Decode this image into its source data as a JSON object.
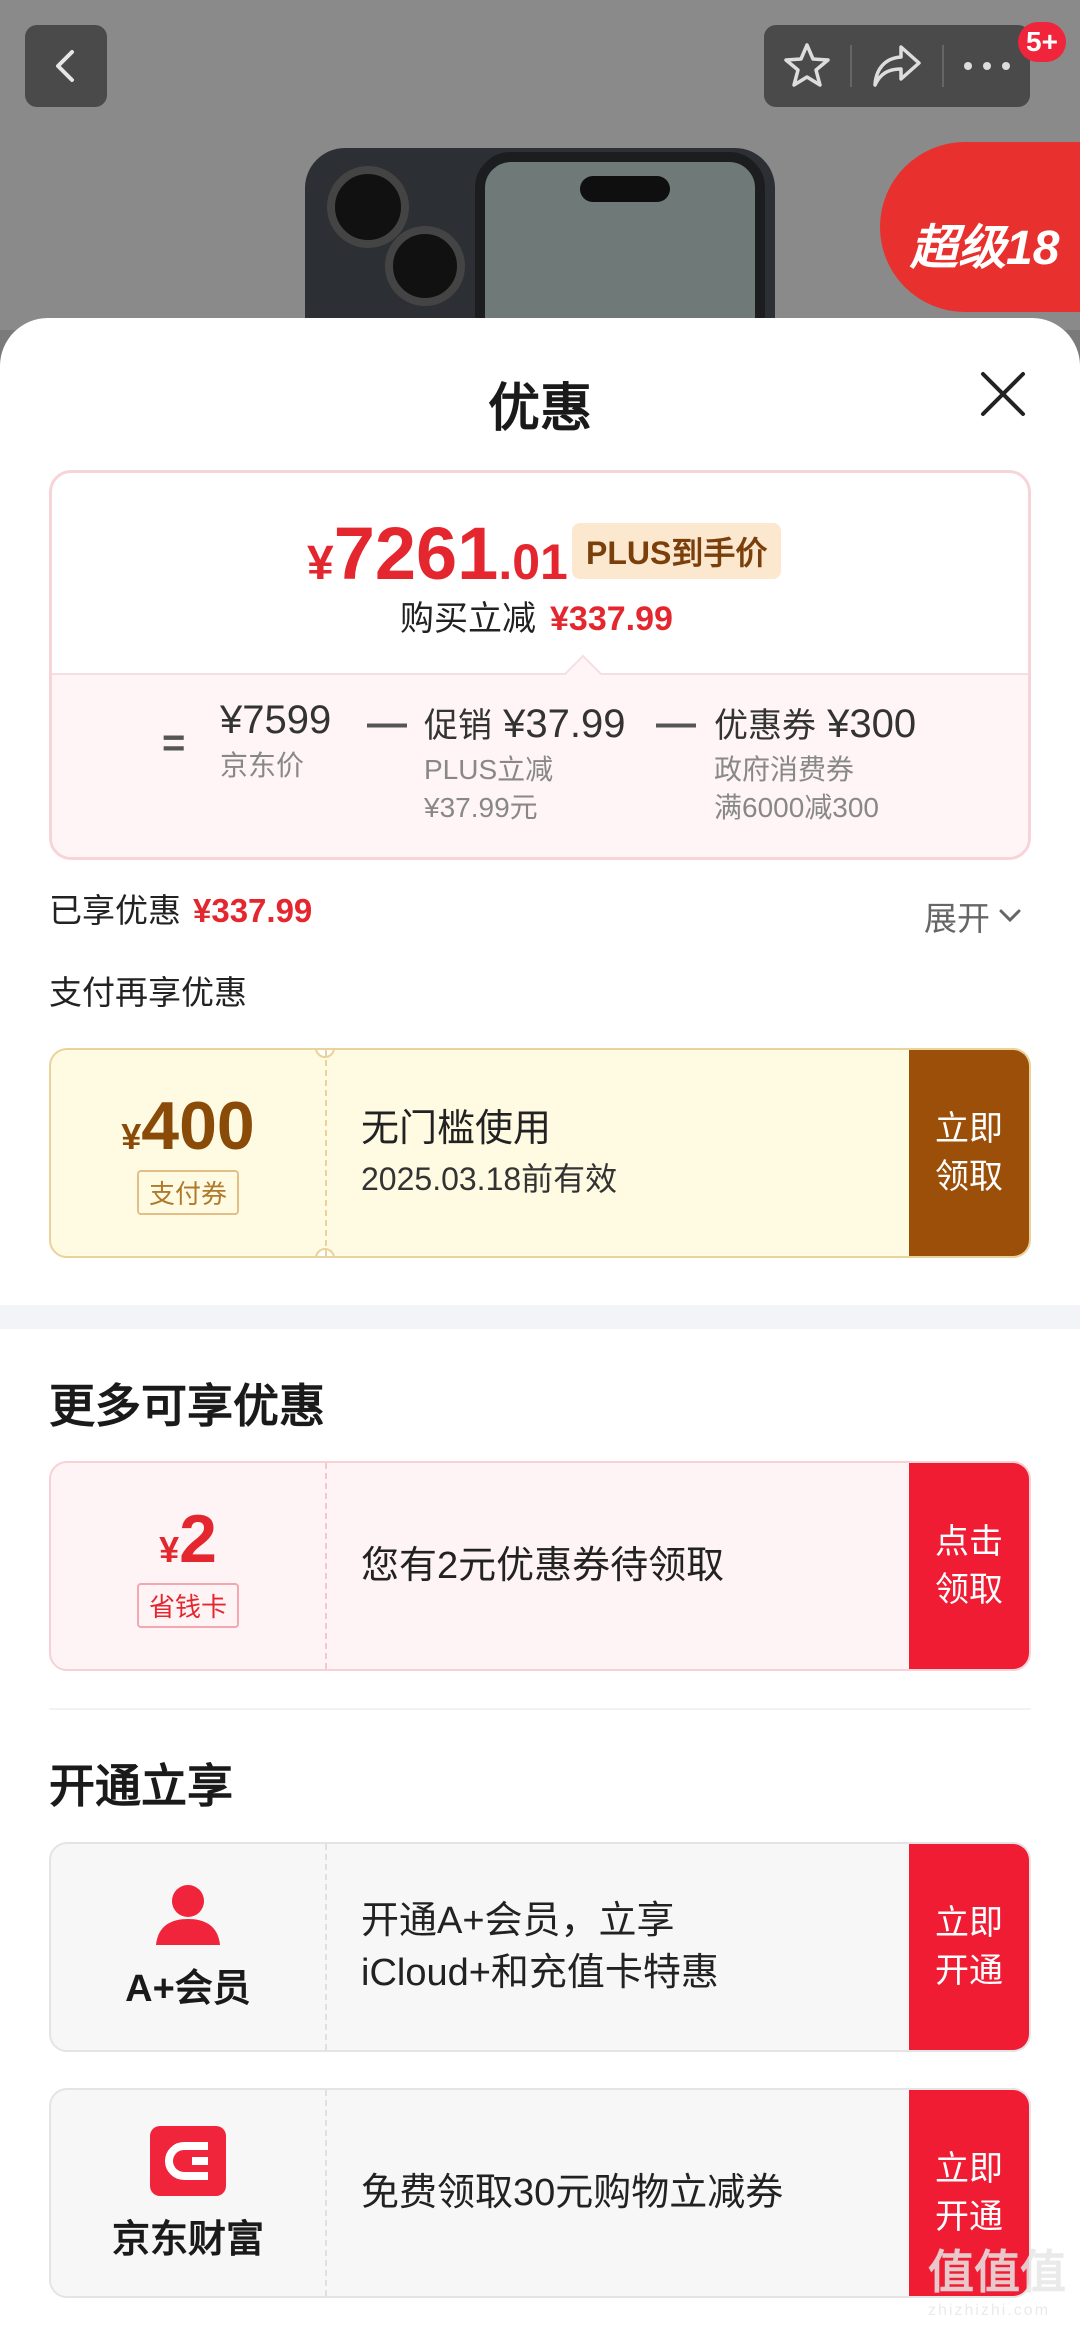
{
  "header": {
    "badge_count": "5+",
    "promo_badge_text": "超级18"
  },
  "sheet": {
    "title": "优惠"
  },
  "price_card": {
    "final_currency": "¥",
    "final_int": "7261",
    "final_dec": ".01",
    "plus_tag": "PLUS到手价",
    "buy_save_label": "购买立减",
    "buy_save_value": "¥337.99",
    "equals": "=",
    "minus": "—",
    "base_price": "¥7599",
    "base_label": "京东价",
    "promo_label": "促销",
    "promo_value": "¥37.99",
    "promo_sub1": "PLUS立减",
    "promo_sub2": "¥37.99元",
    "coupon_label": "优惠券",
    "coupon_value": "¥300",
    "coupon_sub1": "政府消费券",
    "coupon_sub2": "满6000减300"
  },
  "enjoyed": {
    "label": "已享优惠",
    "value": "¥337.99",
    "expand": "展开"
  },
  "pay_more": {
    "title": "支付再享优惠",
    "coupon": {
      "currency": "¥",
      "amount": "400",
      "tag": "支付券",
      "line1": "无门槛使用",
      "line2": "2025.03.18前有效",
      "cta_line1": "立即",
      "cta_line2": "领取"
    }
  },
  "more": {
    "title": "更多可享优惠",
    "coupon": {
      "currency": "¥",
      "amount": "2",
      "tag": "省钱卡",
      "line1": "您有2元优惠券待领取",
      "cta_line1": "点击",
      "cta_line2": "领取"
    }
  },
  "open": {
    "title": "开通立享",
    "items": [
      {
        "name": "A+会员",
        "icon": "person-icon",
        "line1": "开通A+会员，立享",
        "line2": "iCloud+和充值卡特惠",
        "cta_line1": "立即",
        "cta_line2": "开通"
      },
      {
        "name": "京东财富",
        "icon": "jd-wallet-icon",
        "line1": "免费领取30元购物立减券",
        "cta_line1": "立即",
        "cta_line2": "开通"
      }
    ]
  },
  "watermark": {
    "main": "值值值",
    "sub": "zhizhizhi.com"
  },
  "colors": {
    "accent_red": "#e4262e",
    "cta_red": "#f01c34",
    "cta_brown": "#9c4f09"
  }
}
